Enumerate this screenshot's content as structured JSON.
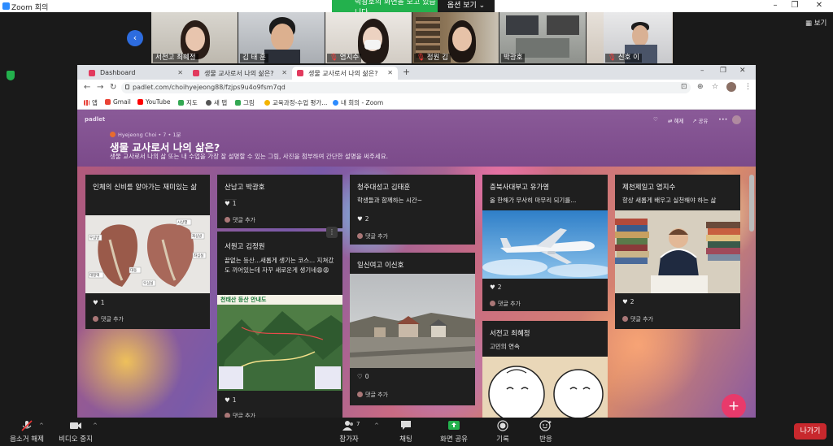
{
  "zoom": {
    "window_title": "Zoom 회의",
    "share_banner": "박광호의 화면을 보고 있습니다.",
    "view_options": "옵션 보기",
    "view_label": "보기",
    "participants": [
      {
        "name": "서전고 최혜정",
        "muted": false
      },
      {
        "name": "김 태 훈",
        "muted": false
      },
      {
        "name": "염지수",
        "muted": true
      },
      {
        "name": "정원 김",
        "muted": true
      },
      {
        "name": "박광호",
        "muted": false
      },
      {
        "name": "신호 이",
        "muted": true
      }
    ],
    "toolbar": {
      "audio": "음소거 해제",
      "video": "비디오 중지",
      "participants": "참가자",
      "participants_count": "7",
      "chat": "채팅",
      "share": "화면 공유",
      "record": "기록",
      "reactions": "반응",
      "leave": "나가기"
    }
  },
  "browser": {
    "tabs": [
      {
        "label": "Dashboard"
      },
      {
        "label": "생물 교사로서 나의 삶은?"
      },
      {
        "label": "생물 교사로서 나의 삶은?"
      }
    ],
    "new_tab": "+",
    "url": "padlet.com/choihyejeong88/fzjps9u4o9fsm7qd",
    "bookmarks": [
      "앱",
      "Gmail",
      "YouTube",
      "지도",
      "새 탭",
      "그림",
      "교육과정-수업 평가...",
      "내 회의 - Zoom"
    ]
  },
  "padlet": {
    "logo": "padlet",
    "author": "Hyejeong Choi",
    "author_meta": "• 7 • 1분",
    "title": "생물 교사로서 나의 삶은?",
    "description": "생물 교사로서 나의 삶 또는 내 수업을 가장 잘 설명할 수 있는 그림, 사진을 첨부하여 간단한 설명을 써주세요.",
    "actions": {
      "remake": "혜제",
      "share": "공유"
    },
    "comment_label": "댓글 추가",
    "cards": {
      "c1": {
        "title": "인체의 신비를 알아가는 재미있는 삶",
        "likes": "1",
        "image_labels": [
          "시상열",
          "좌심방",
          "우심방",
          "좌심실",
          "대동",
          "우심실",
          "대정맥"
        ]
      },
      "c2": {
        "title": "산남고 박광호",
        "likes": "1"
      },
      "c3": {
        "title": "서원고 김정원",
        "body": "끝없는 등산...새롭게 생기는 코스... 지쳐갔도 끼어있는데 자꾸 새로운게 생기네😩😩",
        "likes": "1",
        "map_title": "천태산 등산 안내도"
      },
      "c4": {
        "title": "청주대성고 김태훈",
        "body": "학생들과 함께하는 시간~",
        "likes": "2"
      },
      "c5": {
        "title": "일신여고 이신호",
        "likes": "0"
      },
      "c6": {
        "title": "충북사대부고 유가영",
        "body": "올 한해가 무사히 마무리 되기를...",
        "likes": "2"
      },
      "c7": {
        "title": "서전고 최혜정",
        "body": "고민의 연속"
      },
      "c8": {
        "title": "제천제일고 염지수",
        "body": "항상 새롭게 배우고 실천해야 하는 삶",
        "likes": "2"
      }
    }
  }
}
